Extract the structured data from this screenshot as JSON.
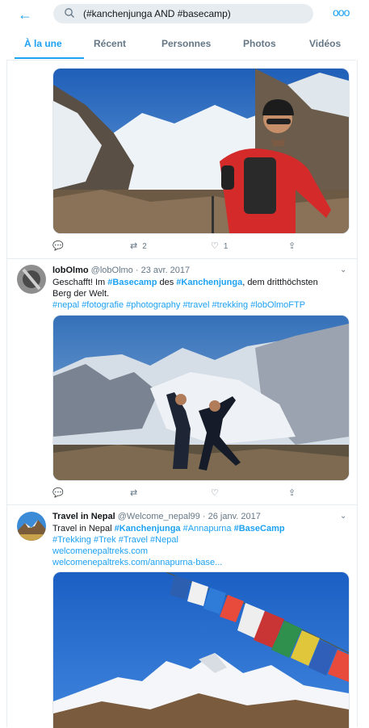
{
  "search": {
    "query": "(#kanchenjunga AND #basecamp)"
  },
  "tabs": [
    "À la une",
    "Récent",
    "Personnes",
    "Photos",
    "Vidéos"
  ],
  "tweet1": {
    "retweets": "2",
    "likes": "1"
  },
  "tweet2": {
    "name": "lobOlmo",
    "handle": "@lobOlmo",
    "sep": "·",
    "date": "23 avr. 2017",
    "line1_a": "Geschafft! Im ",
    "line1_b": "#Basecamp",
    "line1_c": " des ",
    "line1_d": "#Kanchenjunga",
    "line1_e": ", dem dritthöchsten",
    "line2": "Berg der Welt.",
    "hashtags": "#nepal #fotografie #photography #travel #trekking #lobOlmoFTP"
  },
  "tweet3": {
    "name": "Travel in Nepal",
    "handle": "@Welcome_nepal99",
    "sep": "·",
    "date": "26 janv. 2017",
    "t_a": "Travel in Nepal ",
    "t_b": "#Kanchenjunga",
    "t_c": " #Annapurna ",
    "t_d": "#BaseCamp",
    "hashtags": "#Trekking #Trek #Travel #Nepal",
    "link1": "welcomenepaltreks.com",
    "link2": "welcomenepaltreks.com/annapurna-base..."
  },
  "colors": {
    "accent": "#1da1f2",
    "text": "#14171a",
    "muted": "#657786",
    "border": "#e6ecf0"
  }
}
